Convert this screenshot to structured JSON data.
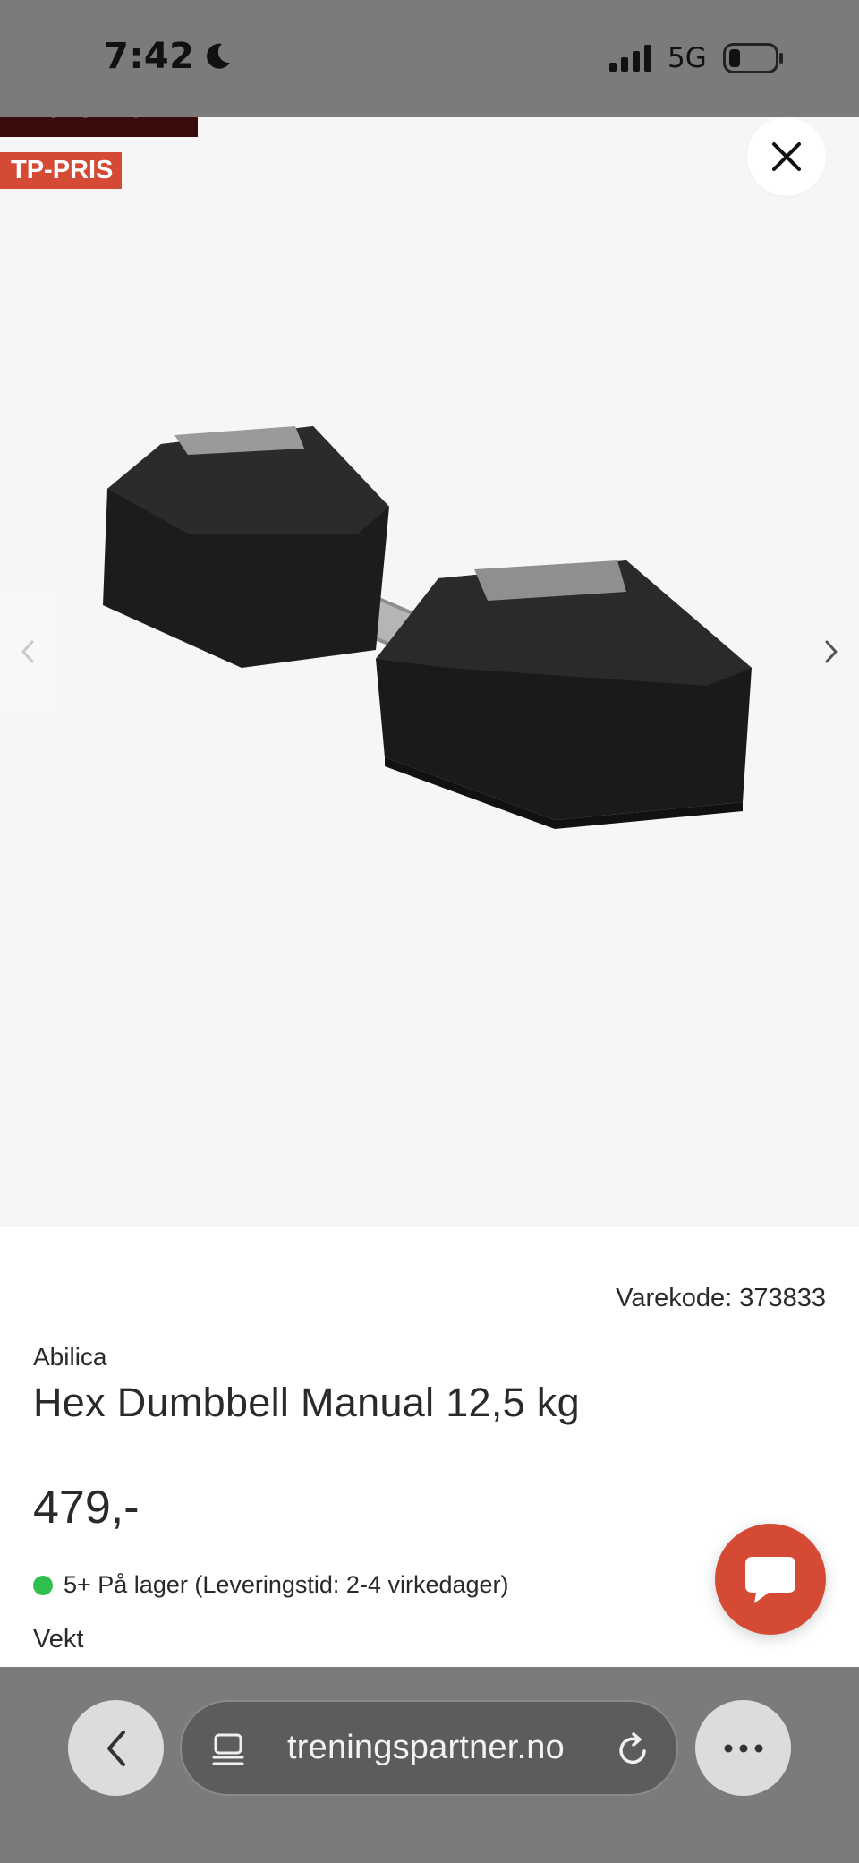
{
  "status_bar": {
    "time": "7:42",
    "network": "5G",
    "icons": [
      "moon-icon",
      "signal-icon",
      "battery-icon"
    ]
  },
  "gallery": {
    "badges": [
      "BESTSELGER",
      "TP-PRIS"
    ],
    "image": "hex-dumbbell-image",
    "colors": {
      "bestseller_badge": "#3b0c0c",
      "tp_badge": "#d44a34",
      "background": "#f6f6f6"
    }
  },
  "product": {
    "sku_label": "Varekode: 373833",
    "brand": "Abilica",
    "title": "Hex Dumbbell Manual 12,5 kg",
    "price": "479,-",
    "stock": "5+ På lager (Leveringstid: 2-4 virkedager)",
    "variant_label": "Vekt"
  },
  "chat": {
    "icon": "chat-bubble-icon",
    "color": "#d44a34"
  },
  "browser": {
    "url": "treningspartner.no",
    "icons": [
      "back-chevron-icon",
      "tabs-icon",
      "reload-icon",
      "more-icon"
    ]
  }
}
